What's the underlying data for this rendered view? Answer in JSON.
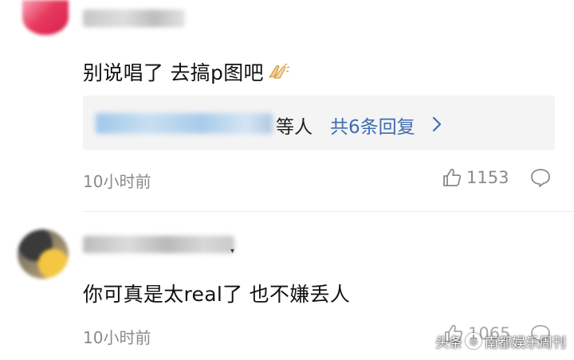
{
  "comments": [
    {
      "text": "别说唱了 去搞p图吧",
      "emoji": "clapping-hands-emoji",
      "reply_summary": {
        "suffix": "等人",
        "link": "共6条回复"
      },
      "time": "10小时前",
      "likes": "1153"
    },
    {
      "text": "你可真是太real了 也不嫌丢人",
      "time": "10小时前",
      "likes": "1065"
    }
  ],
  "watermark": {
    "label": "头条",
    "account": "南都娱乐周刊"
  },
  "colors": {
    "link": "#3f6cb0",
    "meta_text": "#8a8a8a",
    "reply_background": "#f4f4f5"
  }
}
